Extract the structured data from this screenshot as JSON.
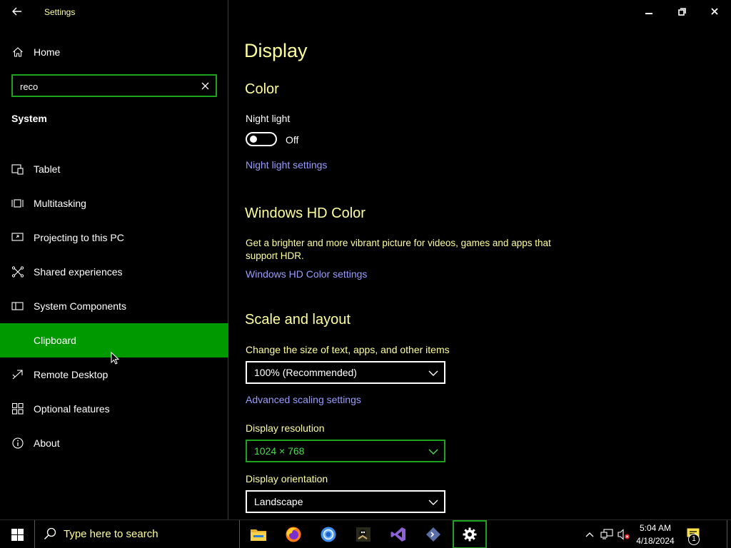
{
  "app": {
    "title": "Settings"
  },
  "colors": {
    "accent": "#009900",
    "focus_border": "#1ea21e",
    "heading": "#ffff9a",
    "link": "#9a9cff",
    "background": "#000000"
  },
  "sidebar": {
    "home_label": "Home",
    "search": {
      "value": "reco",
      "placeholder": ""
    },
    "section_label": "System",
    "items": [
      {
        "label": "Tablet",
        "icon": "tablet-icon",
        "active": false
      },
      {
        "label": "Multitasking",
        "icon": "multitasking-icon",
        "active": false
      },
      {
        "label": "Projecting to this PC",
        "icon": "projecting-icon",
        "active": false
      },
      {
        "label": "Shared experiences",
        "icon": "shared-experiences-icon",
        "active": false
      },
      {
        "label": "System Components",
        "icon": "system-components-icon",
        "active": false
      },
      {
        "label": "Clipboard",
        "icon": "clipboard-icon",
        "active": true
      },
      {
        "label": "Remote Desktop",
        "icon": "remote-desktop-icon",
        "active": false
      },
      {
        "label": "Optional features",
        "icon": "optional-features-icon",
        "active": false
      },
      {
        "label": "About",
        "icon": "info-icon",
        "active": false
      }
    ]
  },
  "main": {
    "title": "Display",
    "color": {
      "heading": "Color",
      "night_light_label": "Night light",
      "night_light_state": "Off",
      "night_light_link": "Night light settings"
    },
    "hd_color": {
      "heading": "Windows HD Color",
      "description_line1": "Get a brighter and more vibrant picture for videos, games and apps that",
      "description_line2": "support HDR.",
      "link": "Windows HD Color settings"
    },
    "scale": {
      "heading": "Scale and layout",
      "size_label": "Change the size of text, apps, and other items",
      "size_value": "100% (Recommended)",
      "advanced_link": "Advanced scaling settings",
      "resolution_label": "Display resolution",
      "resolution_value": "1024 × 768",
      "orientation_label": "Display orientation",
      "orientation_value": "Landscape"
    }
  },
  "taskbar": {
    "search_text": "Type here to search",
    "apps": [
      "file-explorer-icon",
      "firefox-icon",
      "chrome-icon",
      "game-app-icon",
      "visual-studio-icon",
      "dev-tool-icon",
      "settings-gear-icon"
    ],
    "clock_time": "5:04 AM",
    "clock_date": "4/18/2024",
    "notification_count": "1"
  }
}
